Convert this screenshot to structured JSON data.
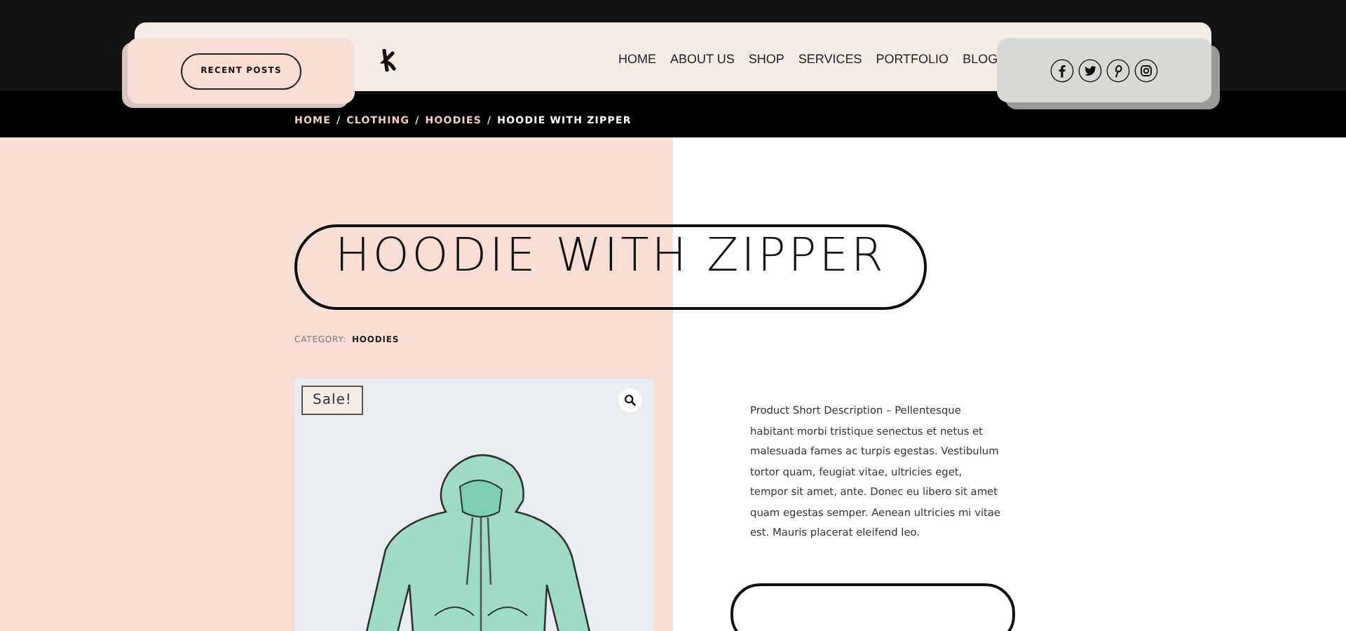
{
  "header": {
    "recent_posts_button": "RECENT POSTS",
    "nav": [
      {
        "label": "HOME"
      },
      {
        "label": "ABOUT US"
      },
      {
        "label": "SHOP"
      },
      {
        "label": "SERVICES"
      },
      {
        "label": "PORTFOLIO"
      },
      {
        "label": "BLOG"
      }
    ],
    "social": [
      {
        "kind": "facebook"
      },
      {
        "kind": "twitter"
      },
      {
        "kind": "pinterest"
      },
      {
        "kind": "instagram"
      }
    ]
  },
  "breadcrumb": [
    {
      "label": "HOME",
      "current": false
    },
    {
      "label": "CLOTHING",
      "current": false
    },
    {
      "label": "HOODIES",
      "current": false
    },
    {
      "label": "HOODIE WITH ZIPPER",
      "current": true
    }
  ],
  "breadcrumb_separator": "/",
  "product": {
    "title": "HOODIE WITH ZIPPER",
    "category_label": "CATEGORY:",
    "category": "HOODIES",
    "sale_badge": "Sale!",
    "description": "Product Short Description – Pellentesque habitant morbi tristique senectus et netus et malesuada fames ac turpis egestas. Vestibulum tortor quam, feugiat vitae, ultricies eget, tempor sit amet, ante. Donec eu libero sit amet quam egestas semper. Aenean ultricies mi vitae est. Mauris placerat eleifend leo."
  }
}
